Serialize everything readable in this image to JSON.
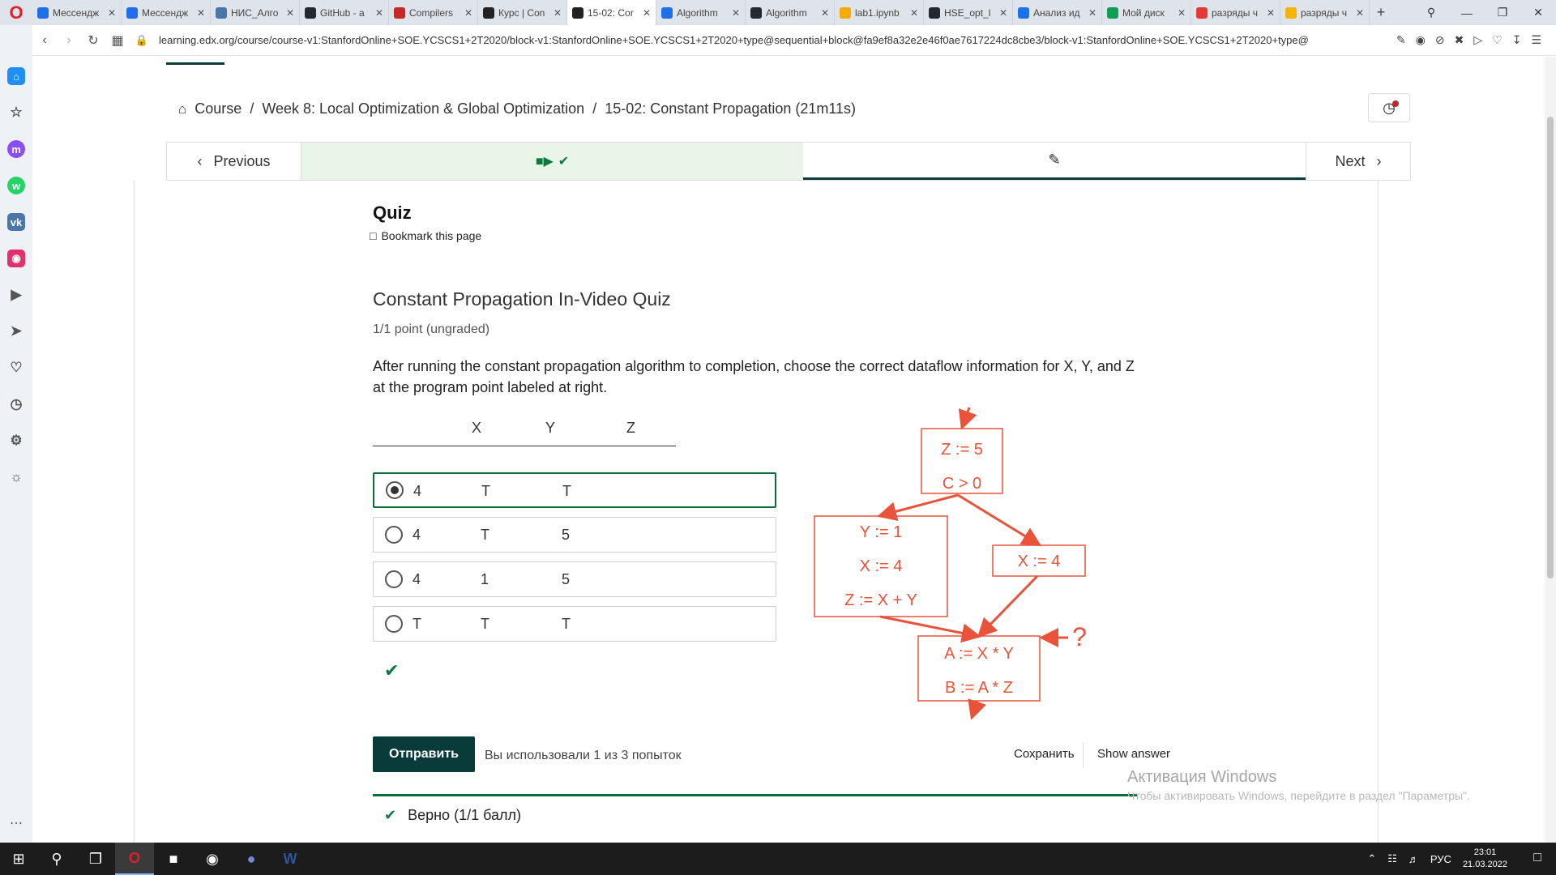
{
  "browser": {
    "tabs": [
      {
        "label": "Мессендж",
        "color": "#1f6feb"
      },
      {
        "label": "Мессендж",
        "color": "#1f6feb"
      },
      {
        "label": "НИС_Алго",
        "color": "#4a76a8"
      },
      {
        "label": "GitHub - a",
        "color": "#24292f"
      },
      {
        "label": "Compilers",
        "color": "#c62828"
      },
      {
        "label": "Курс | Con",
        "color": "#222222"
      },
      {
        "label": "15-02: Cor",
        "color": "#222222"
      },
      {
        "label": "Algorithm",
        "color": "#1f6feb"
      },
      {
        "label": "Algorithm",
        "color": "#24292f"
      },
      {
        "label": "lab1.ipynb",
        "color": "#f9ab00"
      },
      {
        "label": "HSE_opt_l",
        "color": "#24292f"
      },
      {
        "label": "Анализ ид",
        "color": "#1a73e8"
      },
      {
        "label": "Мой диск",
        "color": "#0f9d58"
      },
      {
        "label": "разряды ч",
        "color": "#e53935"
      },
      {
        "label": "разряды ч",
        "color": "#f4b400"
      }
    ],
    "active_tab_index": 6,
    "url": "learning.edx.org/course/course-v1:StanfordOnline+SOE.YCSCS1+2T2020/block-v1:StanfordOnline+SOE.YCSCS1+2T2020+type@sequential+block@fa9ef8a32e2e46f0ae7617224dc8cbe3/block-v1:StanfordOnline+SOE.YCSCS1+2T2020+type@"
  },
  "breadcrumb": {
    "course": "Course",
    "sep1": "/",
    "week": "Week 8: Local Optimization & Global Optimization",
    "sep2": "/",
    "unit": "15-02: Constant Propagation (21m11s)"
  },
  "seqnav": {
    "previous": "Previous",
    "next": "Next"
  },
  "unit": {
    "title": "Quiz",
    "bookmark": "Bookmark this page"
  },
  "problem": {
    "title": "Constant Propagation In-Video Quiz",
    "points": "1/1 point (ungraded)",
    "text": "After running the constant propagation algorithm to completion, choose the correct dataflow information for X, Y, and Z at the program point labeled at right.",
    "headers": [
      "X",
      "Y",
      "Z"
    ],
    "options": [
      {
        "x": "4",
        "y": "T",
        "z": "T",
        "selected": true
      },
      {
        "x": "4",
        "y": "T",
        "z": "5",
        "selected": false
      },
      {
        "x": "4",
        "y": "1",
        "z": "5",
        "selected": false
      },
      {
        "x": "T",
        "y": "T",
        "z": "T",
        "selected": false
      }
    ],
    "submit": "Отправить",
    "attempts": "Вы использовали 1 из 3 попыток",
    "save": "Сохранить",
    "show_answer": "Show answer",
    "result": "Верно (1/1 балл)"
  },
  "diagram": {
    "b1_l1": "Z := 5",
    "b1_l2": "C > 0",
    "b2_l1": "Y := 1",
    "b2_l2": "X := 4",
    "b2_l3": "Z := X + Y",
    "b3_l1": "X := 4",
    "b4_l1": "A := X * Y",
    "b4_l2": "B := A * Z",
    "question": "?",
    "color": "#e8533a"
  },
  "watermark": {
    "title": "Активация Windows",
    "sub": "Чтобы активировать Windows, перейдите в раздел \"Параметры\"."
  },
  "taskbar": {
    "lang": "РУС",
    "time": "23:01",
    "date": "21.03.2022"
  }
}
